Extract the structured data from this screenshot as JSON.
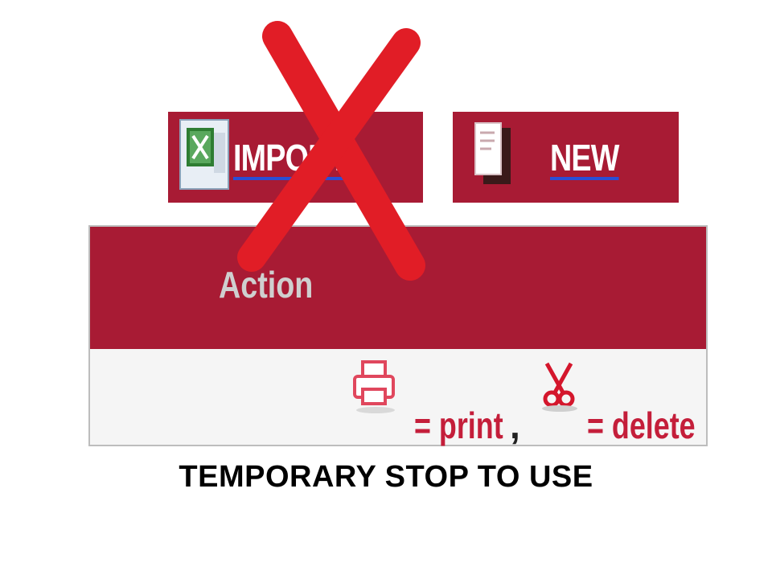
{
  "toolbar": {
    "import_label": "IMPORT",
    "new_label": "NEW",
    "import_icon": "excel-file-icon",
    "new_icon": "document-copy-icon"
  },
  "table": {
    "header": "Action",
    "legend": {
      "print_icon": "print-icon",
      "print_text": "= print",
      "separator": ",",
      "delete_icon": "scissors-icon",
      "delete_text": "= delete"
    }
  },
  "notice": "TEMPORARY STOP TO USE",
  "colors": {
    "button_bg": "#a81b34",
    "header_text": "#cfcfcf",
    "legend_text": "#c41e3a",
    "cross": "#e11d26",
    "underline": "#2a4fd6"
  }
}
